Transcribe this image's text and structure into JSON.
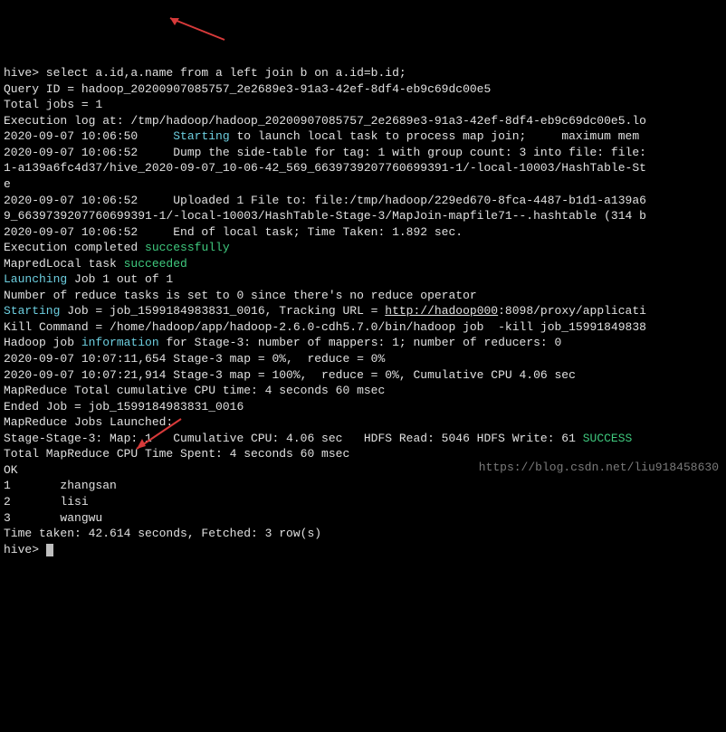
{
  "lines": [
    {
      "segments": [
        {
          "t": "hive> select a.id,a.name from a left join b on a.id=b.id;"
        }
      ]
    },
    {
      "segments": [
        {
          "t": "Query ID = hadoop_20200907085757_2e2689e3-91a3-42ef-8df4-eb9c69dc00e5"
        }
      ]
    },
    {
      "segments": [
        {
          "t": "Total jobs = 1"
        }
      ]
    },
    {
      "segments": [
        {
          "t": "Execution log at: /tmp/hadoop/hadoop_20200907085757_2e2689e3-91a3-42ef-8df4-eb9c69dc00e5.lo"
        }
      ]
    },
    {
      "segments": [
        {
          "t": "2020-09-07 10:06:50     "
        },
        {
          "t": "Starting",
          "cls": "kw-cyan"
        },
        {
          "t": " to launch local task to process map join;     maximum mem"
        }
      ]
    },
    {
      "segments": [
        {
          "t": "2020-09-07 10:06:52     Dump the side-table for tag: 1 with group count: 3 into file: file:"
        }
      ]
    },
    {
      "segments": [
        {
          "t": "1-a139a6fc4d37/hive_2020-09-07_10-06-42_569_6639739207760699391-1/-local-10003/HashTable-St"
        }
      ]
    },
    {
      "segments": [
        {
          "t": "e"
        }
      ]
    },
    {
      "segments": [
        {
          "t": "2020-09-07 10:06:52     Uploaded 1 File to: file:/tmp/hadoop/229ed670-8fca-4487-b1d1-a139a6"
        }
      ]
    },
    {
      "segments": [
        {
          "t": "9_6639739207760699391-1/-local-10003/HashTable-Stage-3/MapJoin-mapfile71--.hashtable (314 b"
        }
      ]
    },
    {
      "segments": [
        {
          "t": "2020-09-07 10:06:52     End of local task; Time Taken: 1.892 sec."
        }
      ]
    },
    {
      "segments": [
        {
          "t": "Execution completed "
        },
        {
          "t": "successfully",
          "cls": "kw-green"
        }
      ]
    },
    {
      "segments": [
        {
          "t": "MapredLocal task "
        },
        {
          "t": "succeeded",
          "cls": "kw-green"
        }
      ]
    },
    {
      "segments": [
        {
          "t": "Launching",
          "cls": "kw-cyan"
        },
        {
          "t": " Job 1 out of 1"
        }
      ]
    },
    {
      "segments": [
        {
          "t": "Number of reduce tasks is set to 0 since there's no reduce operator"
        }
      ]
    },
    {
      "segments": [
        {
          "t": "Starting",
          "cls": "kw-cyan"
        },
        {
          "t": " Job = job_1599184983831_0016, Tracking URL = "
        },
        {
          "t": "http://hadoop000",
          "cls": "underline"
        },
        {
          "t": ":8098/proxy/applicati"
        }
      ]
    },
    {
      "segments": [
        {
          "t": "Kill Command = /home/hadoop/app/hadoop-2.6.0-cdh5.7.0/bin/hadoop job  -kill job_15991849838"
        }
      ]
    },
    {
      "segments": [
        {
          "t": "Hadoop job "
        },
        {
          "t": "information",
          "cls": "kw-cyan"
        },
        {
          "t": " for Stage-3: number of mappers: 1; number of reducers: 0"
        }
      ]
    },
    {
      "segments": [
        {
          "t": "2020-09-07 10:07:11,654 Stage-3 map = 0%,  reduce = 0%"
        }
      ]
    },
    {
      "segments": [
        {
          "t": "2020-09-07 10:07:21,914 Stage-3 map = 100%,  reduce = 0%, Cumulative CPU 4.06 sec"
        }
      ]
    },
    {
      "segments": [
        {
          "t": "MapReduce Total cumulative CPU time: 4 seconds 60 msec"
        }
      ]
    },
    {
      "segments": [
        {
          "t": "Ended Job = job_1599184983831_0016"
        }
      ]
    },
    {
      "segments": [
        {
          "t": "MapReduce Jobs Launched:"
        }
      ]
    },
    {
      "segments": [
        {
          "t": "Stage-Stage-3: Map: 1   Cumulative CPU: 4.06 sec   HDFS Read: 5046 HDFS Write: 61 "
        },
        {
          "t": "SUCCESS",
          "cls": "kw-green"
        }
      ]
    },
    {
      "segments": [
        {
          "t": "Total MapReduce CPU Time Spent: 4 seconds 60 msec"
        }
      ]
    },
    {
      "segments": [
        {
          "t": "OK"
        }
      ]
    },
    {
      "segments": [
        {
          "t": "1       zhangsan"
        }
      ]
    },
    {
      "segments": [
        {
          "t": "2       lisi"
        }
      ]
    },
    {
      "segments": [
        {
          "t": "3       wangwu"
        }
      ]
    },
    {
      "segments": [
        {
          "t": "Time taken: 42.614 seconds, Fetched: 3 row(s)"
        }
      ]
    },
    {
      "segments": [
        {
          "t": "hive> "
        }
      ],
      "cursor": true
    }
  ],
  "watermark": "https://blog.csdn.net/liu918458630",
  "arrows": {
    "color": "#d73a3a"
  }
}
